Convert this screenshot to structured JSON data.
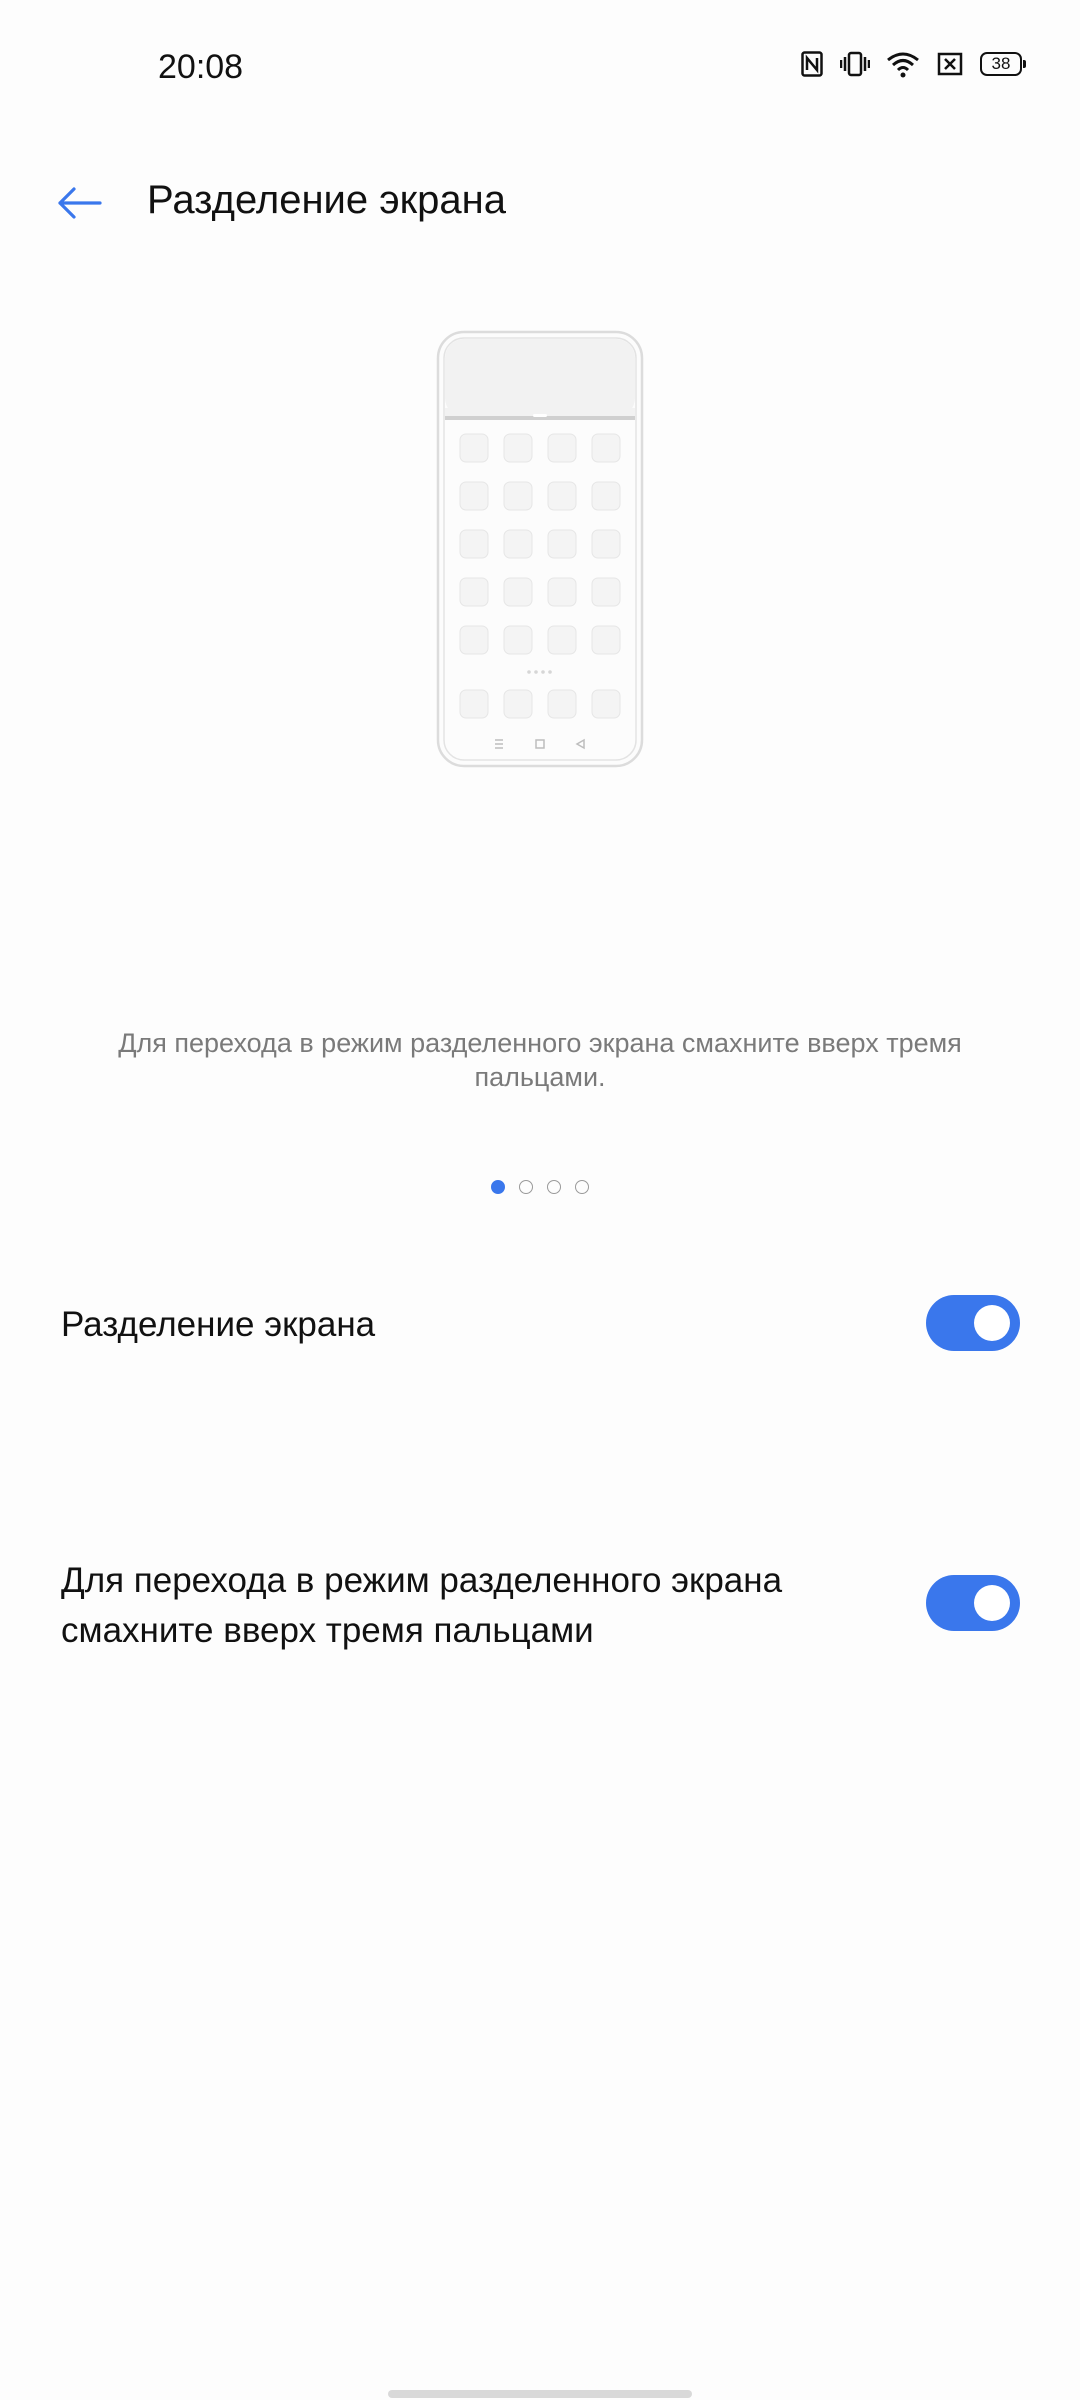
{
  "status_bar": {
    "time": "20:08",
    "battery": "38",
    "icons": [
      "nfc-icon",
      "vibrate-icon",
      "wifi-icon",
      "sim-error-icon",
      "battery-icon"
    ]
  },
  "app_bar": {
    "back_icon": "arrow-left-icon",
    "title": "Разделение экрана"
  },
  "illustration": {
    "icon": "phone-split-screen-illustration"
  },
  "caption": "Для перехода в режим разделенного экрана смахните вверх тремя пальцами.",
  "pager": {
    "total": 4,
    "active_index": 0
  },
  "settings": [
    {
      "label": "Разделение экрана",
      "enabled": true
    },
    {
      "label": "Для перехода в режим разделенного экрана смахните вверх тремя пальцами",
      "enabled": true
    }
  ],
  "colors": {
    "accent": "#3a77ec",
    "background": "#fdfdfd",
    "caption_text": "#7a7a7a",
    "primary_text": "#111111"
  }
}
